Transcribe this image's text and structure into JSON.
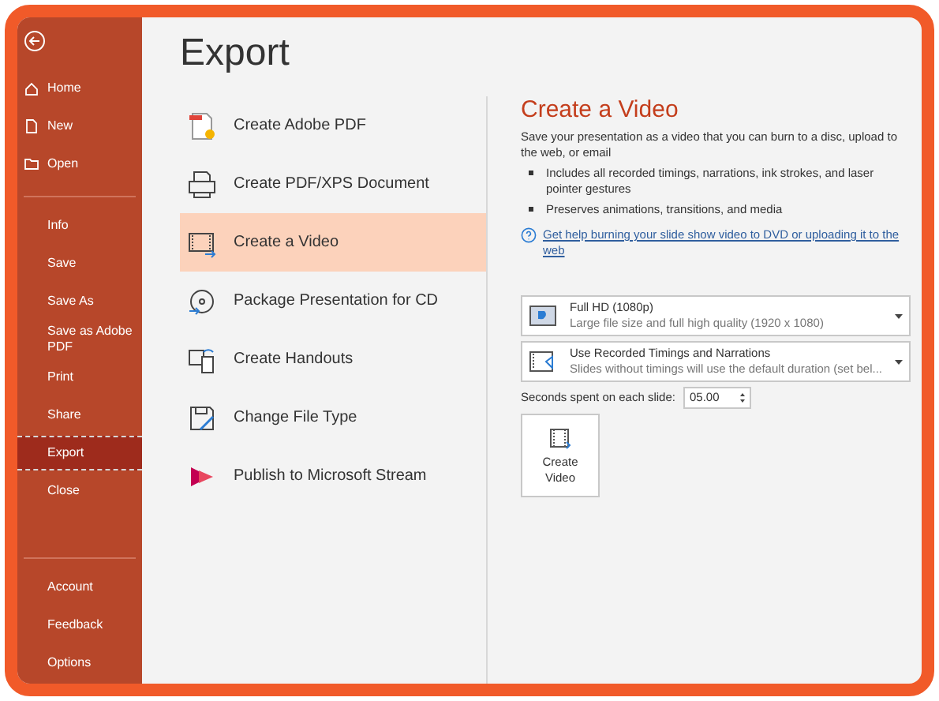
{
  "sidebar": {
    "sections": [
      {
        "items": [
          {
            "label": "Home",
            "selected": false
          },
          {
            "label": "New",
            "selected": false
          },
          {
            "label": "Open",
            "selected": false
          }
        ]
      },
      {
        "items": [
          {
            "label": "Info",
            "selected": false
          },
          {
            "label": "Save",
            "selected": false
          },
          {
            "label": "Save As",
            "selected": false
          },
          {
            "label": "Save as Adobe PDF",
            "selected": false
          },
          {
            "label": "Print",
            "selected": false
          },
          {
            "label": "Share",
            "selected": false
          },
          {
            "label": "Export",
            "selected": true
          },
          {
            "label": "Close",
            "selected": false
          }
        ]
      },
      {
        "items": [
          {
            "label": "Account",
            "selected": false
          },
          {
            "label": "Feedback",
            "selected": false
          },
          {
            "label": "Options",
            "selected": false
          }
        ]
      }
    ]
  },
  "page_title": "Export",
  "export_options": [
    {
      "label": "Create Adobe PDF",
      "selected": false
    },
    {
      "label": "Create PDF/XPS Document",
      "selected": false
    },
    {
      "label": "Create a Video",
      "selected": true
    },
    {
      "label": "Package Presentation for CD",
      "selected": false
    },
    {
      "label": "Create Handouts",
      "selected": false
    },
    {
      "label": "Change File Type",
      "selected": false
    },
    {
      "label": "Publish to Microsoft Stream",
      "selected": false
    }
  ],
  "detail": {
    "title": "Create a Video",
    "description": "Save your presentation as a video that you can burn to a disc, upload to the web, or email",
    "bullets": [
      "Includes all recorded timings, narrations, ink strokes, and laser pointer gestures",
      "Preserves animations, transitions, and media"
    ],
    "help_link": "Get help burning your slide show video to DVD or uploading it to the web",
    "dropdowns": [
      {
        "title": "Full HD (1080p)",
        "subtitle": "Large file size and full high quality (1920 x 1080)"
      },
      {
        "title": "Use Recorded Timings and Narrations",
        "subtitle": "Slides without timings will use the default duration (set bel..."
      }
    ],
    "seconds": {
      "label": "Seconds spent on each slide:",
      "value": "05.00"
    },
    "create_button": "Create Video"
  }
}
